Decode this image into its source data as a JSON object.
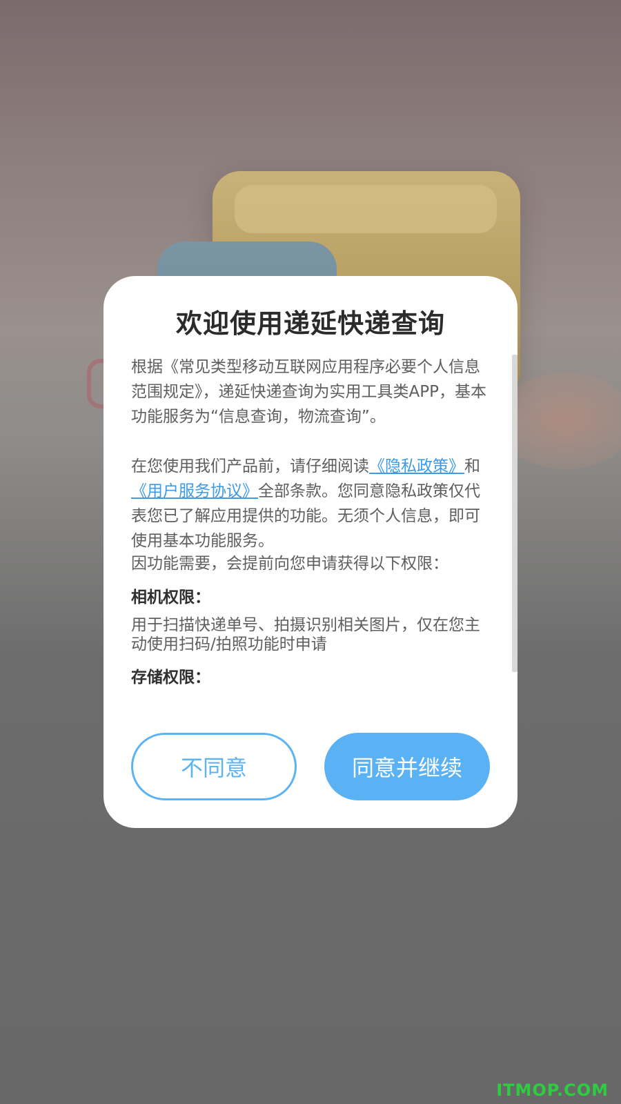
{
  "dialog": {
    "title": "欢迎使用递延快递查询",
    "intro": "根据《常见类型移动互联网应用程序必要个人信息范围规定》，递延快递查询为实用工具类APP，基本功能服务为“信息查询，物流查询”。",
    "read_prefix": "在您使用我们产品前，请仔细阅读",
    "privacy_link": "《隐私政策》",
    "and_text": "和",
    "service_link": "《用户服务协议》",
    "read_suffix": "全部条款。您同意隐私政策仅代表您已了解应用提供的功能。无须个人信息，即可使用基本功能服务。",
    "permissions_intro": "因功能需要，会提前向您申请获得以下权限：",
    "permissions": [
      {
        "title": "相机权限：",
        "desc": "用于扫描快递单号、拍摄识别相关图片，仅在您主动使用扫码/拍照功能时申请"
      },
      {
        "title": "存储权限：",
        "desc": ""
      }
    ],
    "decline_label": "不同意",
    "accept_label": "同意并继续"
  },
  "watermark": "ITMOP.COM",
  "colors": {
    "accent": "#5ab2f5",
    "link": "#3b9be8",
    "watermark": "#2ecc40"
  }
}
